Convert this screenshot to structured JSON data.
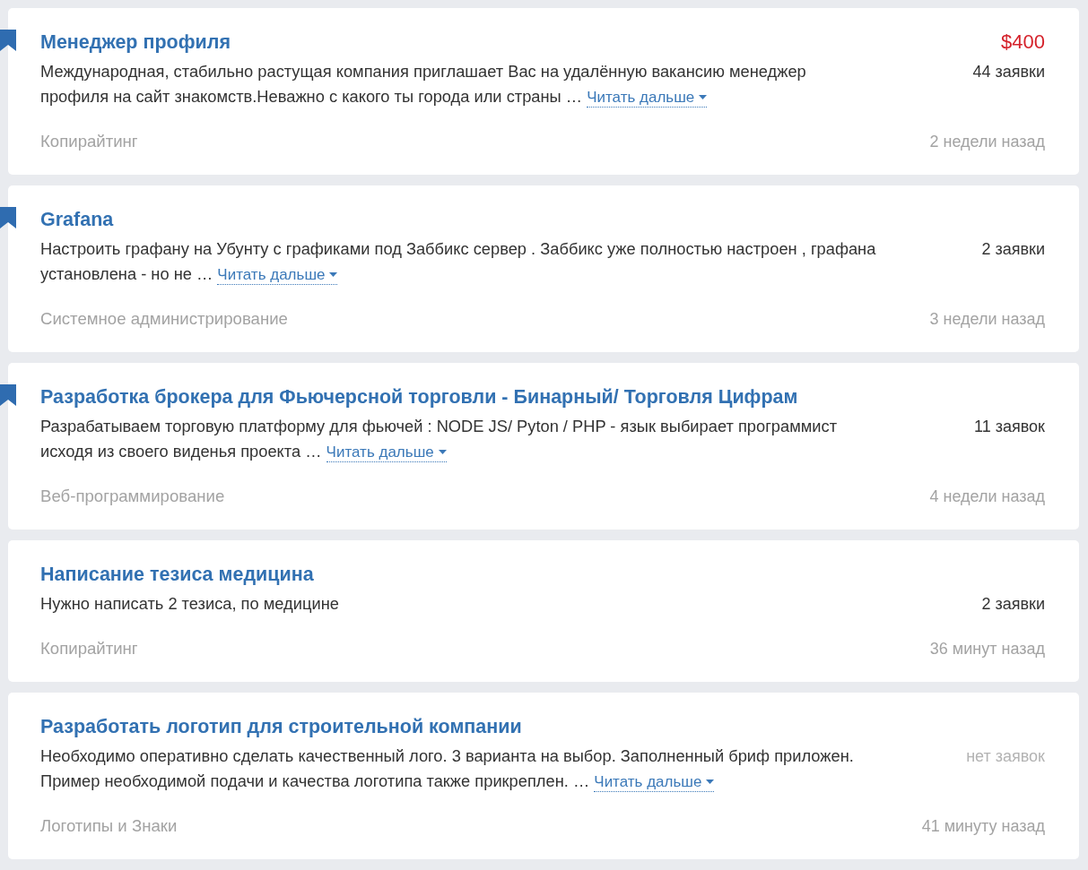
{
  "jobs": [
    {
      "title": "Менеджер профиля",
      "pinned": true,
      "price": "$400",
      "description": "Международная, стабильно растущая компания приглашает Вас на удалённую вакансию менеджер профиля на сайт знакомств.Неважно с какого ты города или страны …",
      "read_more": "Читать дальше",
      "bids": "44 заявки",
      "bids_dimmed": false,
      "category": "Копирайтинг",
      "posted": "2 недели назад"
    },
    {
      "title": "Grafana",
      "pinned": true,
      "description": "Настроить графану на Убунту с графиками под Заббикс сервер . Заббикс уже полностью настроен , графана установлена - но не …",
      "read_more": "Читать дальше",
      "bids": "2 заявки",
      "bids_dimmed": false,
      "category": "Системное администрирование",
      "posted": "3 недели назад"
    },
    {
      "title": "Разработка брокера для Фьючерсной торговли - Бинарный/ Торговля Цифрам",
      "pinned": true,
      "description": "Разрабатываем торговую платформу для фьючей : NODE JS/ Pyton / PHP - язык выбирает программист исходя из своего виденья проекта … ",
      "read_more": "Читать дальше",
      "bids": "11 заявок",
      "bids_dimmed": false,
      "category": "Веб-программирование",
      "posted": "4 недели назад"
    },
    {
      "title": "Написание тезиса медицина",
      "pinned": false,
      "description": "Нужно написать 2 тезиса, по медицине",
      "bids": "2 заявки",
      "bids_dimmed": false,
      "category": "Копирайтинг",
      "posted": "36 минут назад"
    },
    {
      "title": "Разработать логотип для строительной компании",
      "pinned": false,
      "description": "Необходимо оперативно сделать качественный лого. 3 варианта на выбор. Заполненный бриф приложен. Пример необходимой подачи и качества логотипа также прикреплен. …",
      "read_more": "Читать дальше",
      "bids": "нет заявок",
      "bids_dimmed": true,
      "category": "Логотипы и Знаки",
      "posted": "41 минуту назад"
    }
  ]
}
